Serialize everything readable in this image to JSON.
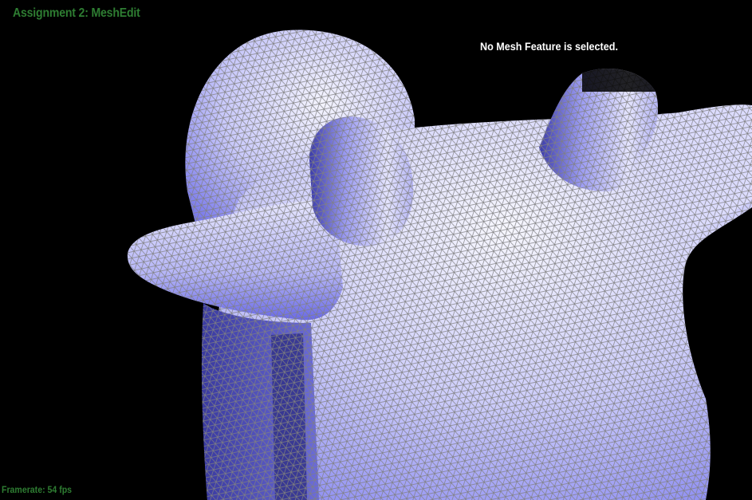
{
  "app": {
    "title": "Assignment 2: MeshEdit"
  },
  "status": {
    "selection": "No Mesh Feature is selected.",
    "framerate": "Framerate: 54 fps"
  },
  "colors": {
    "background": "#000000",
    "title_text": "#2e7d32",
    "status_text": "#ffffff",
    "framerate_text": "#2e7d32",
    "mesh_fill": "#a9a9f5",
    "mesh_highlight": "#f2f2ff",
    "mesh_shadow": "#5a5ae0",
    "wireframe": "#808080"
  }
}
